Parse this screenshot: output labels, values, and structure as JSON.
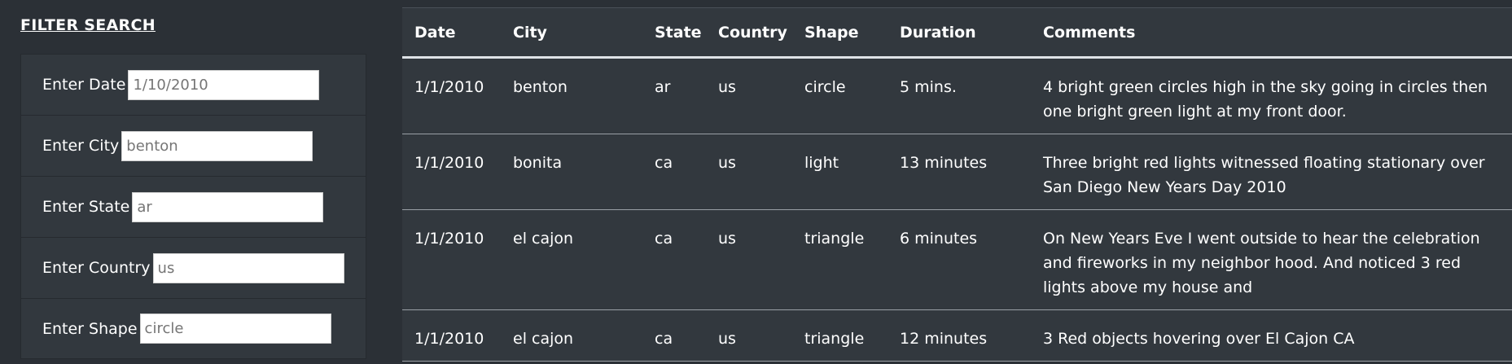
{
  "filter": {
    "title": "FILTER SEARCH",
    "fields": [
      {
        "label": "Enter Date",
        "value": "1/10/2010",
        "width_class": "w-date"
      },
      {
        "label": "Enter City",
        "value": "benton",
        "width_class": "w-city"
      },
      {
        "label": "Enter State",
        "value": "ar",
        "width_class": "w-state"
      },
      {
        "label": "Enter Country",
        "value": "us",
        "width_class": "w-country"
      },
      {
        "label": "Enter Shape",
        "value": "circle",
        "width_class": "w-shape"
      }
    ]
  },
  "table": {
    "headers": [
      "Date",
      "City",
      "State",
      "Country",
      "Shape",
      "Duration",
      "Comments"
    ],
    "rows": [
      [
        "1/1/2010",
        "benton",
        "ar",
        "us",
        "circle",
        "5 mins.",
        "4 bright green circles high in the sky going in circles then one bright green light at my front door."
      ],
      [
        "1/1/2010",
        "bonita",
        "ca",
        "us",
        "light",
        "13 minutes",
        "Three bright red lights witnessed floating stationary over San Diego New Years Day 2010"
      ],
      [
        "1/1/2010",
        "el cajon",
        "ca",
        "us",
        "triangle",
        "6 minutes",
        "On New Years Eve I went outside to hear the celebration and fireworks in my neighbor hood. And noticed 3 red lights above my house and"
      ],
      [
        "1/1/2010",
        "el cajon",
        "ca",
        "us",
        "triangle",
        "12 minutes",
        "3 Red objects hovering over El Cajon CA"
      ]
    ]
  }
}
